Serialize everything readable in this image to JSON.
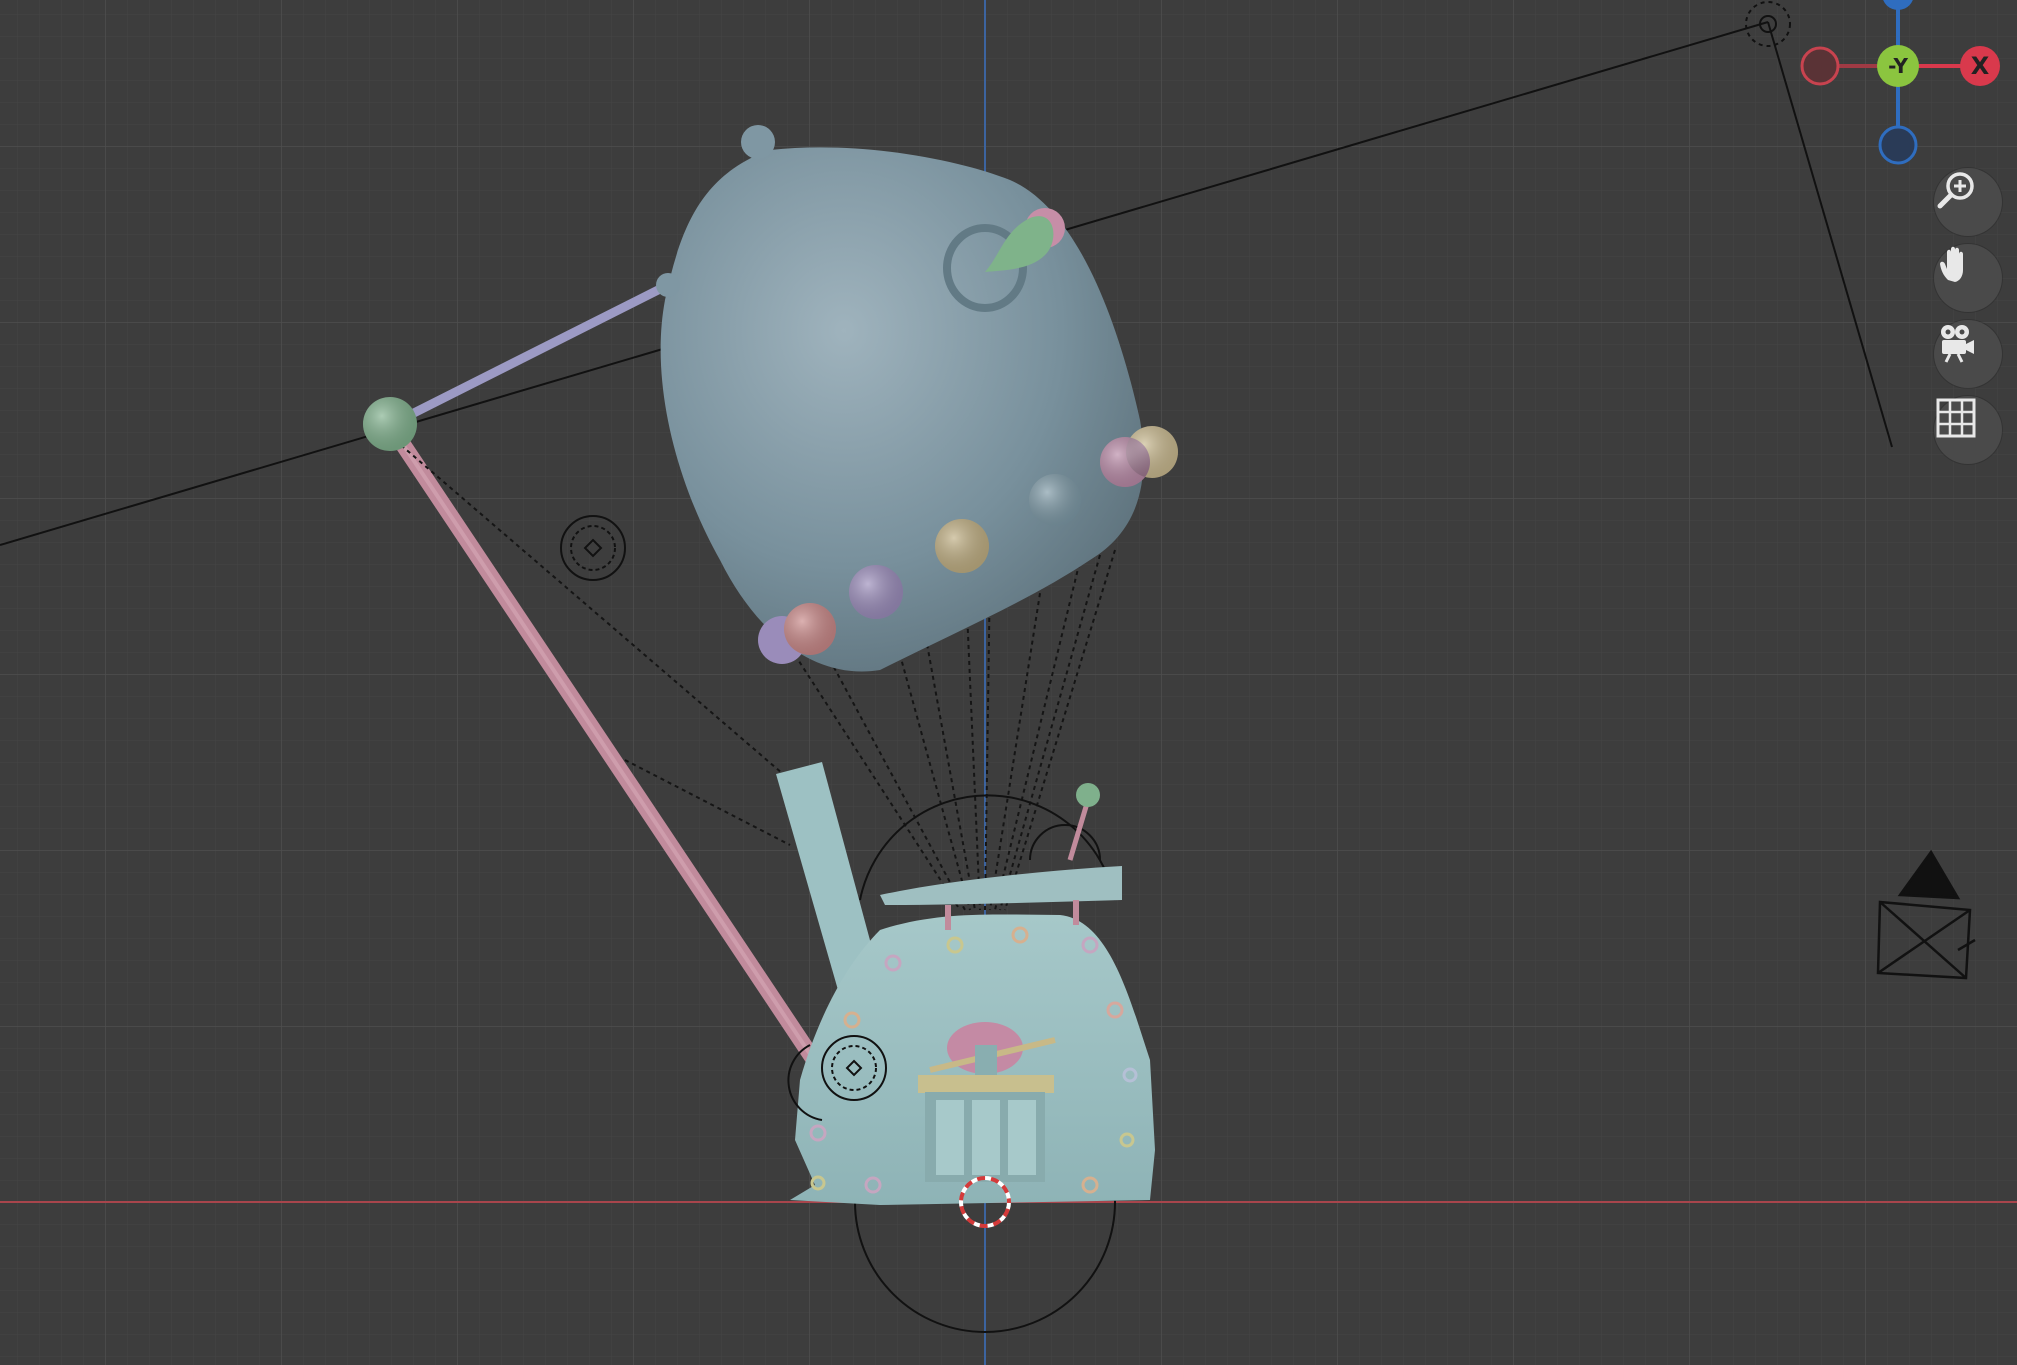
{
  "viewport": {
    "background": "#3d3d3d",
    "grid_color": "#474747",
    "x_axis_color": "#b2484f",
    "z_axis_color": "#3d6aa8"
  },
  "gizmo": {
    "x_label": "X",
    "neg_y_label": "-Y",
    "x_color": "#d9394c",
    "neg_x_color": "#a03a44",
    "y_color": "#8bc53f",
    "z_color": "#2f6dbf",
    "neg_z_color": "#2f6dbf"
  },
  "nav_buttons": [
    {
      "name": "zoom",
      "icon": "zoom-in-icon"
    },
    {
      "name": "pan",
      "icon": "hand-icon"
    },
    {
      "name": "camera-view",
      "icon": "camera-icon"
    },
    {
      "name": "ortho-toggle",
      "icon": "grid-icon"
    }
  ],
  "scene": {
    "balloon_color": "#7f97a3",
    "vehicle_color": "#98bcbe",
    "pole_color": "#c58d9f",
    "knob_color": "#86b58f"
  }
}
